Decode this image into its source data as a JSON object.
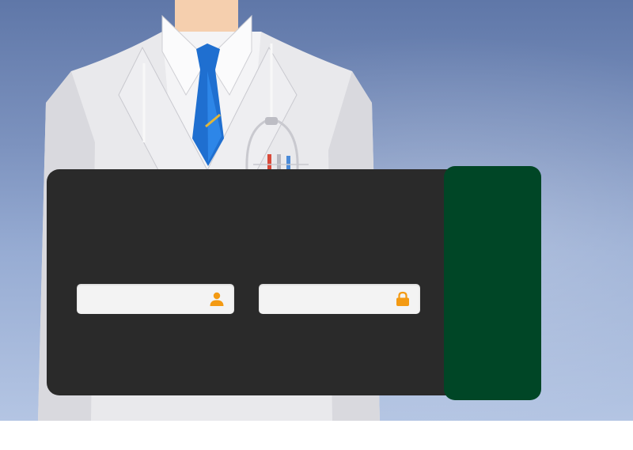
{
  "colors": {
    "background_top": "#5f77a8",
    "background_bottom": "#b4c5e3",
    "login_panel": "#2a2a2a",
    "side_panel": "#004626",
    "field_background": "#f3f3f3",
    "icon_accent": "#f39a13",
    "tie": "#1f6fd0"
  },
  "login": {
    "username": {
      "value": "",
      "placeholder": "",
      "icon": "user-icon"
    },
    "password": {
      "value": "",
      "placeholder": "",
      "icon": "lock-icon"
    }
  }
}
